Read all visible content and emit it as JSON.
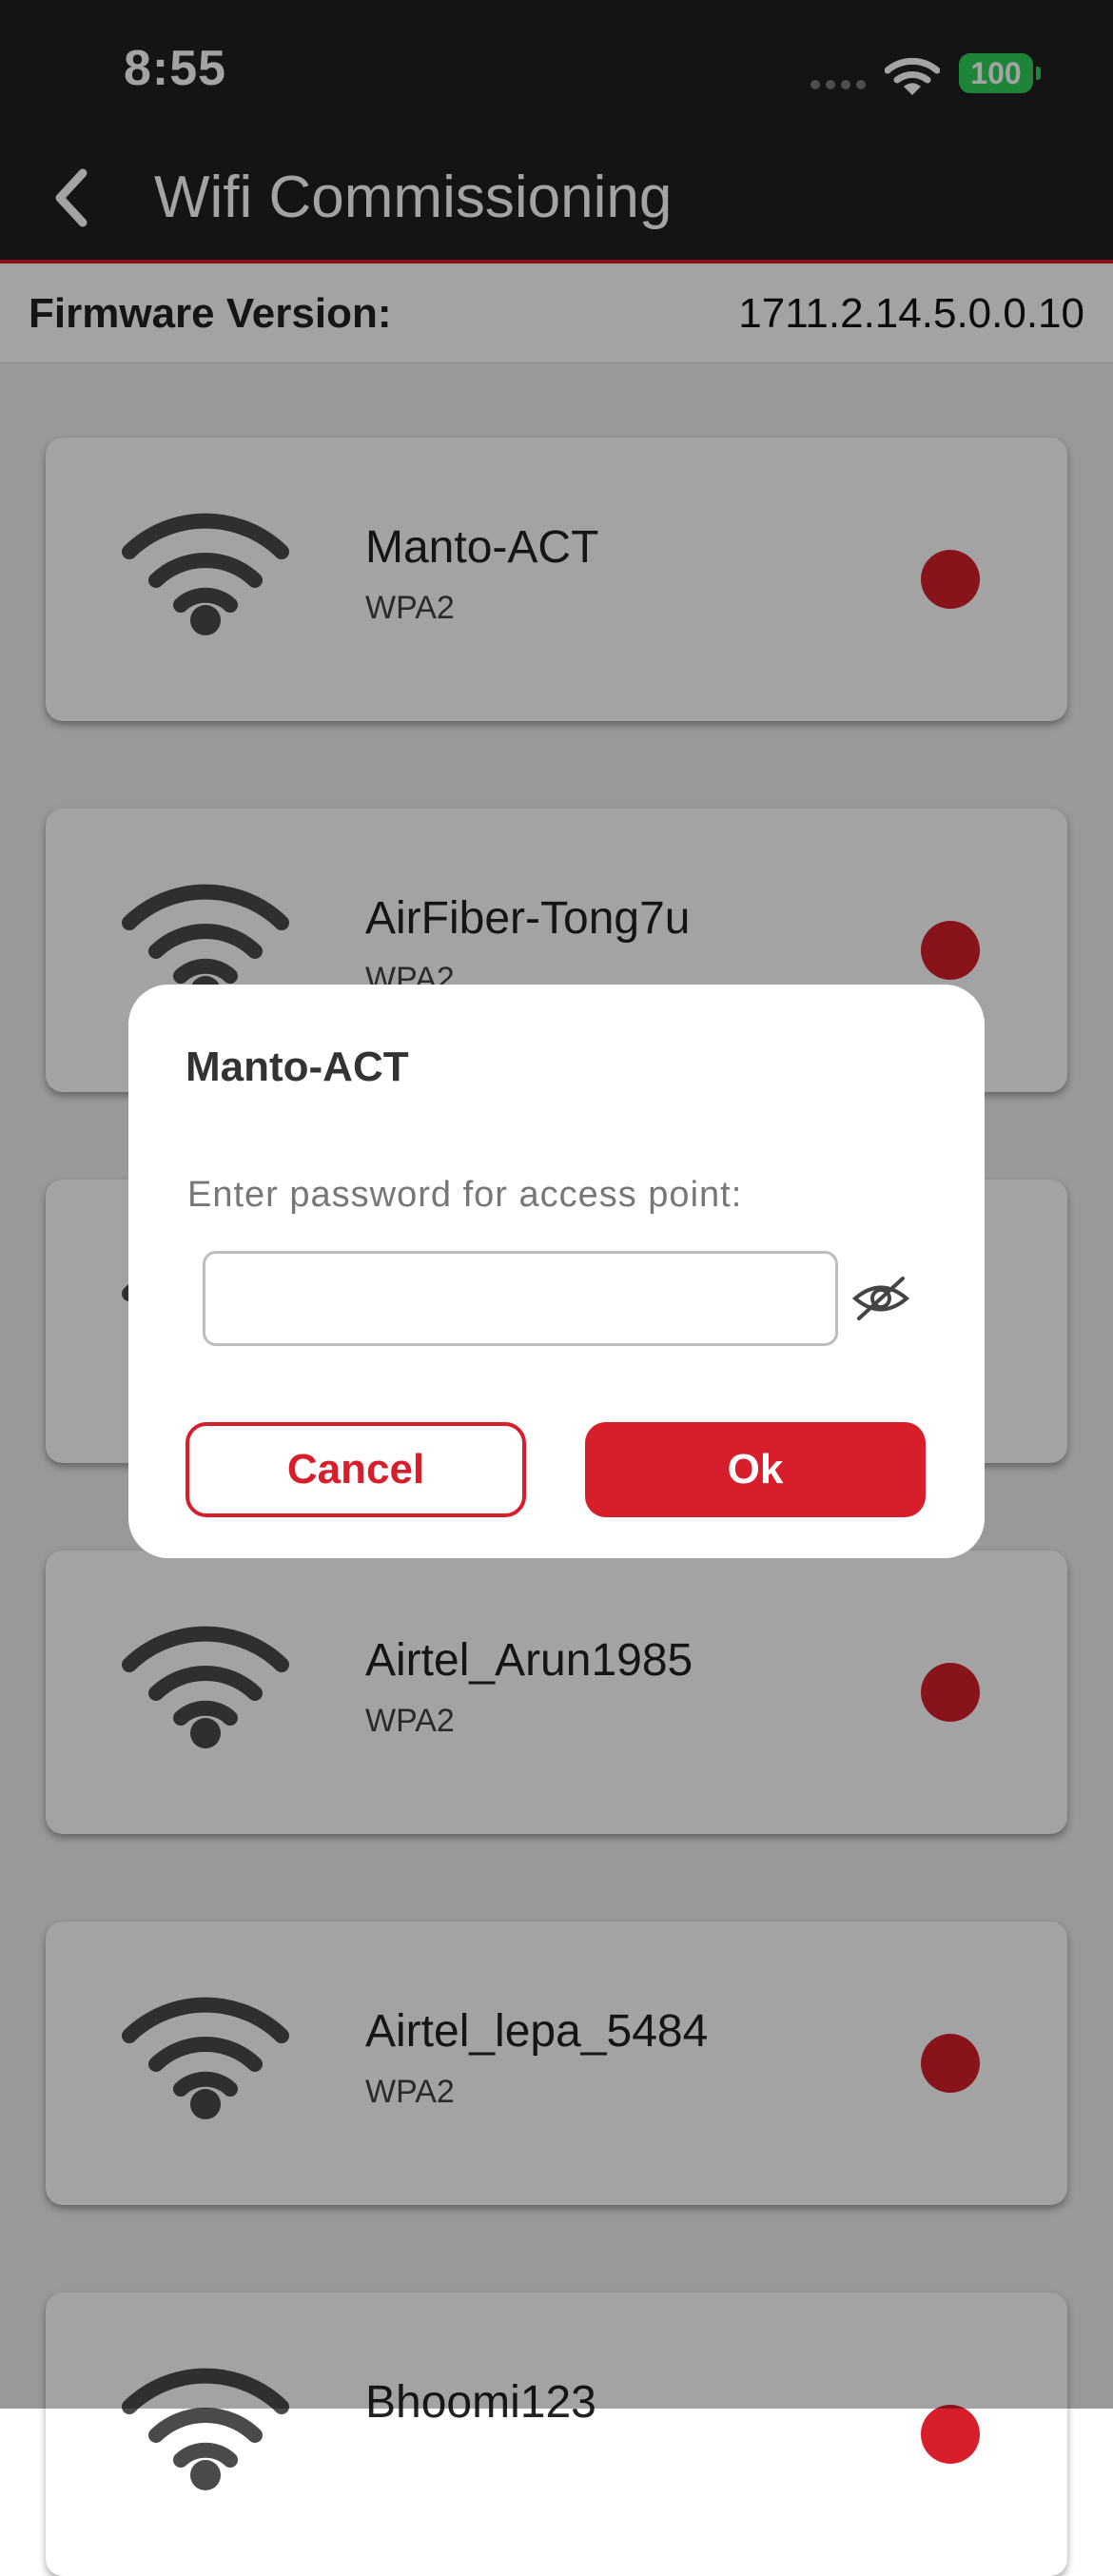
{
  "status_bar": {
    "time": "8:55",
    "battery": "100",
    "battery_color": "#30d158"
  },
  "nav": {
    "back_icon": "chevron-left-icon",
    "title": "Wifi Commissioning"
  },
  "firmware": {
    "label": "Firmware Version:",
    "value": "1711.2.14.5.0.0.10"
  },
  "networks": [
    {
      "ssid": "Manto-ACT",
      "security": "WPA2"
    },
    {
      "ssid": "AirFiber-Tong7u",
      "security": "WPA2"
    },
    {
      "ssid": "",
      "security": ""
    },
    {
      "ssid": "Airtel_Arun1985",
      "security": "WPA2"
    },
    {
      "ssid": "Airtel_lepa_5484",
      "security": "WPA2"
    },
    {
      "ssid": "Bhoomi123",
      "security": ""
    }
  ],
  "dialog": {
    "title": "Manto-ACT",
    "prompt": "Enter password for access point:",
    "password_value": "",
    "toggle_icon": "eye-slash-icon",
    "cancel_label": "Cancel",
    "ok_label": "Ok"
  },
  "colors": {
    "accent": "#d71e2a",
    "bar_bg": "#202020"
  }
}
